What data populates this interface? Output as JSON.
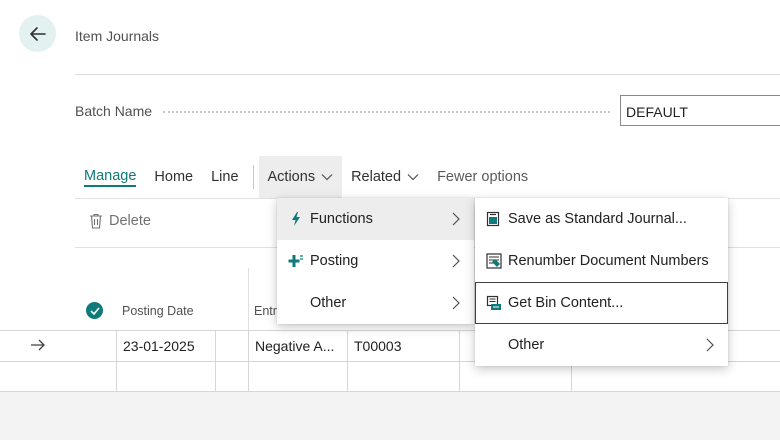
{
  "header": {
    "back_icon": "arrow-left-icon",
    "title": "Item Journals"
  },
  "batch": {
    "label": "Batch Name",
    "value": "DEFAULT"
  },
  "toolbar": {
    "items": [
      {
        "label": "Manage",
        "active": true
      },
      {
        "label": "Home"
      },
      {
        "label": "Line"
      },
      {
        "label": "Actions",
        "dropdown": true,
        "open": true
      },
      {
        "label": "Related",
        "dropdown": true
      },
      {
        "label": "Fewer options"
      }
    ],
    "delete_label": "Delete",
    "delete_icon": "trash-icon"
  },
  "grid": {
    "columns": [
      "Posting Date",
      "Entr"
    ],
    "rows": [
      {
        "posting_date": "23-01-2025",
        "entry_type": "Negative A...",
        "document_no": "T00003"
      }
    ]
  },
  "actions_menu": {
    "items": [
      {
        "label": "Functions",
        "icon": "lightning-icon",
        "submenu": true,
        "selected": true
      },
      {
        "label": "Posting",
        "icon": "post-icon",
        "submenu": true
      },
      {
        "label": "Other",
        "icon": "",
        "submenu": true
      }
    ]
  },
  "functions_menu": {
    "items": [
      {
        "label": "Save as Standard Journal...",
        "icon": "save-journal-icon"
      },
      {
        "label": "Renumber Document Numbers",
        "icon": "renumber-icon"
      },
      {
        "label": "Get Bin Content...",
        "icon": "bin-content-icon",
        "focused": true
      },
      {
        "label": "Other",
        "icon": "",
        "submenu": true
      }
    ]
  },
  "colors": {
    "accent": "#0e7a7a",
    "back_button_bg": "#e4f1f1",
    "menu_selected_bg": "#ededed"
  }
}
